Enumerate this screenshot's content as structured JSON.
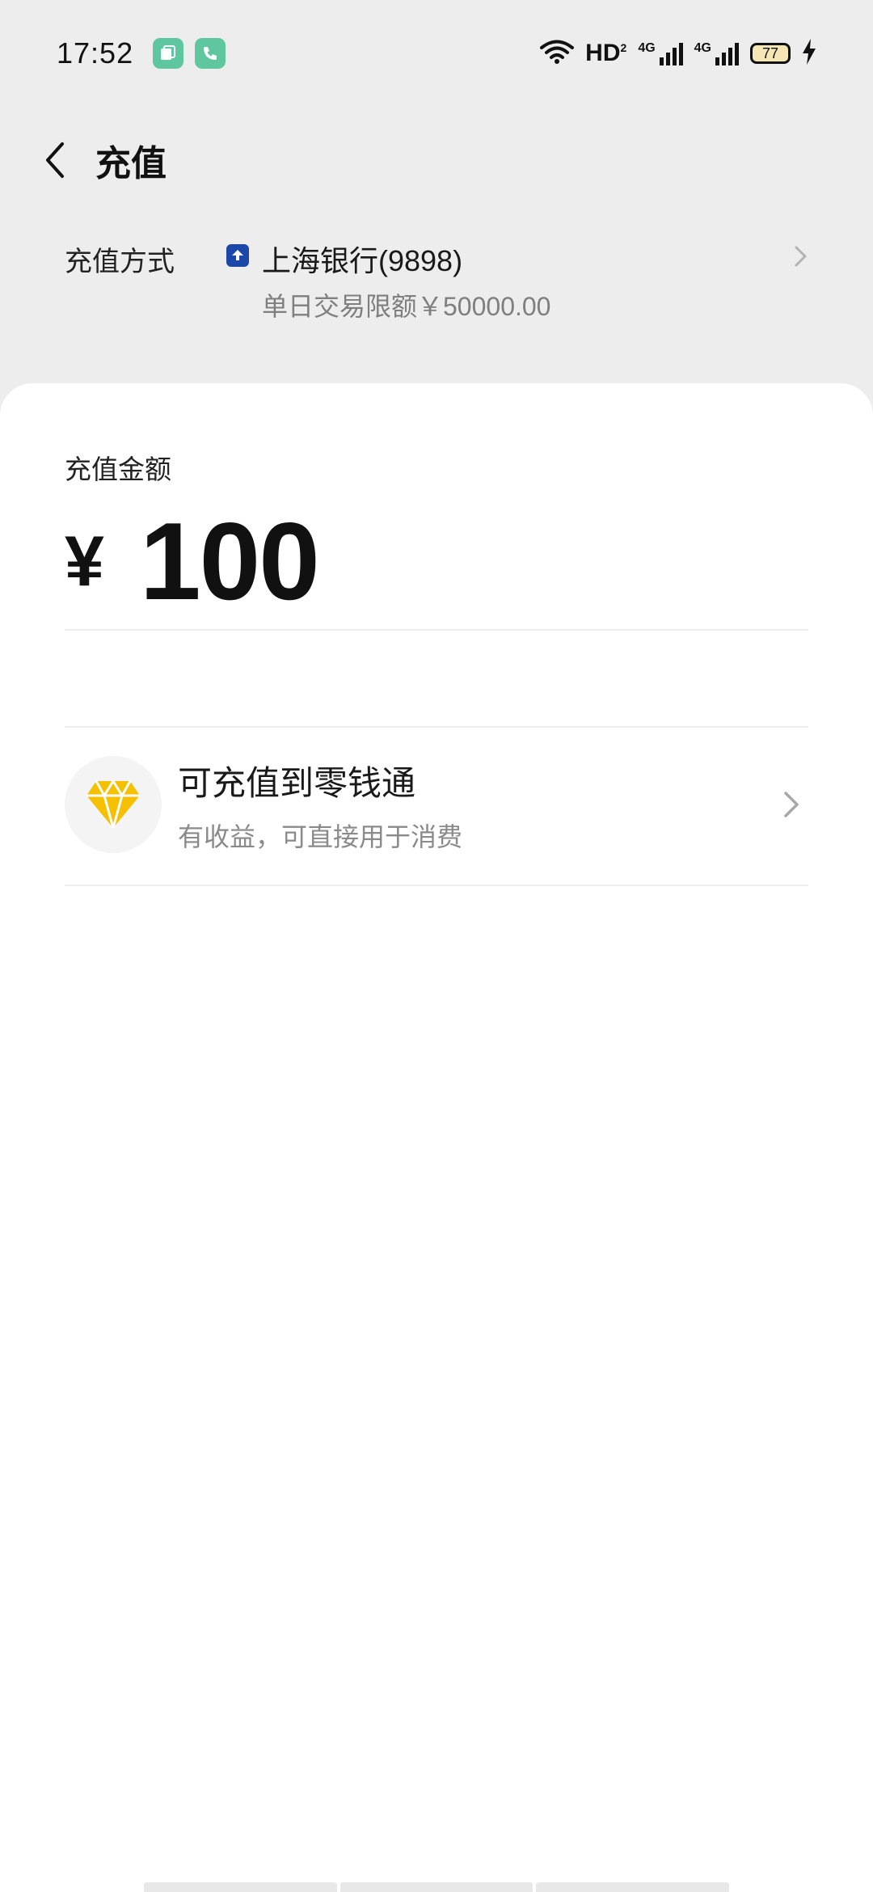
{
  "status_bar": {
    "time": "17:52",
    "network_label": "HD",
    "network_sub": "2",
    "signal_label": "4G",
    "battery": "77",
    "icons": [
      "wifi-icon",
      "hd-icon",
      "signal-4g-icon",
      "signal-4g-icon",
      "battery-icon",
      "charging-icon"
    ],
    "notification_icons": [
      "multi-window-icon",
      "phone-icon"
    ],
    "notification_color": "#5ec7a0"
  },
  "header": {
    "title": "充值",
    "back_icon": "chevron-left-icon"
  },
  "payment_method": {
    "label": "充值方式",
    "bank_name": "上海银行(9898)",
    "limit_text": "单日交易限额￥50000.00",
    "bank_icon": "bank-logo-icon",
    "bank_color": "#1a47a8"
  },
  "amount": {
    "label": "充值金额",
    "currency": "¥",
    "value": "100"
  },
  "lingqiantong": {
    "title": "可充值到零钱通",
    "subtitle": "有收益，可直接用于消费",
    "icon": "diamond-icon",
    "icon_color": "#f5c000"
  },
  "colors": {
    "background": "#ededed",
    "card": "#ffffff",
    "text_primary": "#191919",
    "text_secondary": "#7f7f7f"
  }
}
